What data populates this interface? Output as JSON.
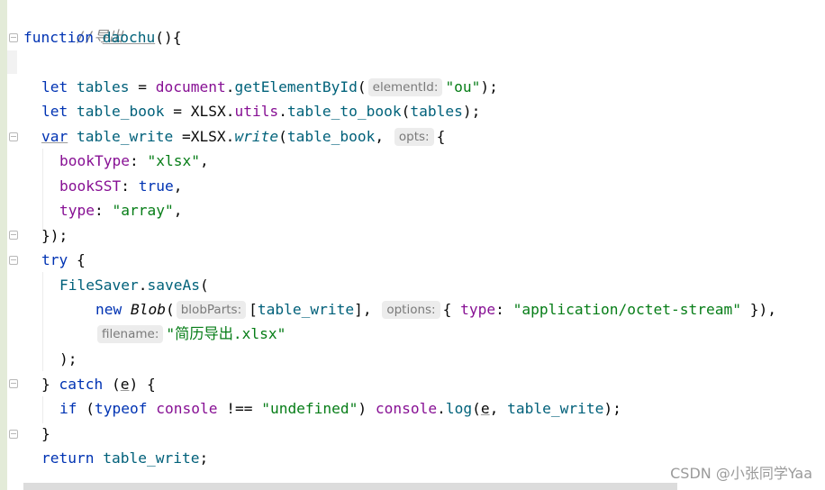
{
  "editor": {
    "comment": "//导出",
    "fn_keyword": "function",
    "fn_name": "daochu",
    "fn_open": "(){",
    "let1": "let",
    "tables_var": "tables",
    "eq1": " = ",
    "document_obj": "document",
    "dot1": ".",
    "get_method": "getElementById",
    "open_paren1": "(",
    "hint_elementId": "elementId:",
    "str_ou": "\"ou\"",
    "close1": ");",
    "let2": "let",
    "table_book_var": "table_book",
    "eq2": " = ",
    "xlsx1": "XLSX",
    "dot2": ".",
    "utils": "utils",
    "dot3": ".",
    "table_to_book": "table_to_book",
    "paren2": "(",
    "tables_arg": "tables",
    "close2": ");",
    "var_kw": "var",
    "table_write_var": "table_write",
    "eq3": " =XLSX.",
    "write_method": "write",
    "paren3": "(",
    "table_book_arg": "table_book",
    "comma3": ", ",
    "hint_opts": "opts:",
    "brace3": "{",
    "bookType_key": "bookType",
    "bookType_colon": ": ",
    "bookType_val": "\"xlsx\"",
    "bookType_comma": ",",
    "bookSST_key": "bookSST",
    "bookSST_colon": ": ",
    "bookSST_val": "true",
    "bookSST_comma": ",",
    "type_key": "type",
    "type_colon": ": ",
    "type_val": "\"array\"",
    "type_comma": ",",
    "close_obj": "});",
    "try_kw": "try",
    "try_brace": " {",
    "filesaver": "FileSaver",
    "dot4": ".",
    "saveAs": "saveAs",
    "paren4": "(",
    "new_kw": "new",
    "blob": "Blob",
    "paren5": "(",
    "hint_blobParts": "blobParts:",
    "bracket_open": "[",
    "table_write_arg": "table_write",
    "bracket_close": "], ",
    "hint_options": "options:",
    "obj_open": "{ ",
    "type_key2": "type",
    "type_colon2": ": ",
    "mime_val": "\"application/octet-stream\"",
    "obj_close": " }),",
    "hint_filename": "filename:",
    "filename_val": "\"简历导出.xlsx\"",
    "close_saveas": ");",
    "catch_open": "} ",
    "catch_kw": "catch",
    "catch_paren": " (",
    "catch_e": "e",
    "catch_close": ") {",
    "if_kw": "if",
    "if_paren": " (",
    "typeof_kw": "typeof",
    "console1": "console",
    "neq": " !== ",
    "undefined_str": "\"undefined\"",
    "if_close": ") ",
    "console2": "console",
    "dot5": ".",
    "log_method": "log",
    "log_paren": "(",
    "log_e": "e",
    "log_comma": ", ",
    "log_tw": "table_write",
    "log_close": ");",
    "close_try": "}",
    "return_kw": "return",
    "return_var": "table_write",
    "return_semi": ";"
  },
  "watermark": "CSDN @小张同学Yaa"
}
